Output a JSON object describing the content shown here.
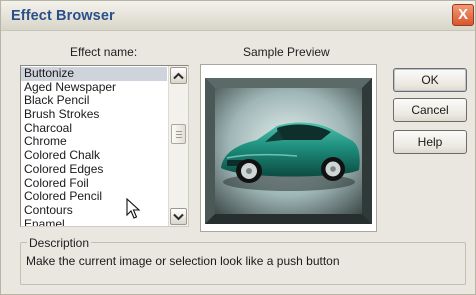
{
  "window": {
    "title": "Effect Browser",
    "close_label": "X"
  },
  "effect_list": {
    "header": "Effect name:",
    "selected_index": 0,
    "items": [
      "Buttonize",
      "Aged Newspaper",
      "Black Pencil",
      "Brush Strokes",
      "Charcoal",
      "Chrome",
      "Colored Chalk",
      "Colored Edges",
      "Colored Foil",
      "Colored Pencil",
      "Contours",
      "Enamel"
    ]
  },
  "preview": {
    "header": "Sample Preview",
    "subject": "teal sports car with buttonize bevel effect"
  },
  "buttons": {
    "ok": "OK",
    "cancel": "Cancel",
    "help": "Help"
  },
  "description": {
    "group_title": "Description",
    "text": "Make the current image or selection look like a push button"
  },
  "icons": {
    "close": "close-icon",
    "scroll_up": "chevron-up-icon",
    "scroll_down": "chevron-down-icon",
    "cursor": "mouse-pointer-icon"
  },
  "colors": {
    "title_text": "#2a4f8a",
    "close_button": "#d9552d",
    "selection": "#cfd4dc",
    "car_body": "#1f8f7e"
  }
}
